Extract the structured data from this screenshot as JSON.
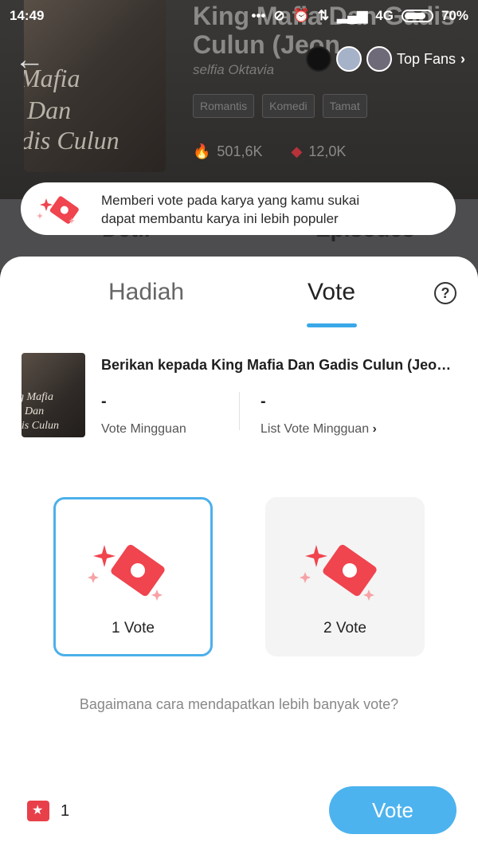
{
  "status_bar": {
    "time": "14:49",
    "network": "4G",
    "battery": "70%",
    "icons": [
      "more-dots-icon",
      "mute-icon",
      "alarm-icon",
      "data-arrows-icon",
      "signal-icon"
    ]
  },
  "book": {
    "title": "King Mafia Dan Gadis Culun (Jeon",
    "cover_text": "King Mafia Dan Gadis Culun",
    "author": "selfia Oktavia",
    "genres": [
      "Romantis",
      "Komedi",
      "Tamat"
    ],
    "views": "501,6K",
    "votes": "12,0K"
  },
  "top_fans": {
    "label": "Top Fans"
  },
  "bg_tabs": {
    "left": "Detil",
    "right": "Episodes"
  },
  "tooltip": {
    "line1": "Memberi vote pada karya yang kamu sukai",
    "line2": "dapat membantu karya ini lebih populer"
  },
  "sheet": {
    "tabs": [
      {
        "label": "Hadiah"
      },
      {
        "label": "Vote"
      }
    ],
    "active_tab": "Vote",
    "help": "?",
    "give_to": "Berikan kepada King Mafia Dan Gadis Culun (Jeon Jungkook)",
    "weekly_vote": {
      "value": "-",
      "label": "Vote Mingguan"
    },
    "weekly_list": {
      "value": "-",
      "label": "List Vote Mingguan"
    },
    "options": [
      {
        "label": "1 Vote",
        "selected": true
      },
      {
        "label": "2 Vote",
        "selected": false
      }
    ],
    "how_to": "Bagaimana cara mendapatkan lebih banyak vote?",
    "balance": "1",
    "vote_button": "Vote"
  },
  "colors": {
    "accent": "#4cb3ef",
    "ticket": "#e8404a"
  }
}
